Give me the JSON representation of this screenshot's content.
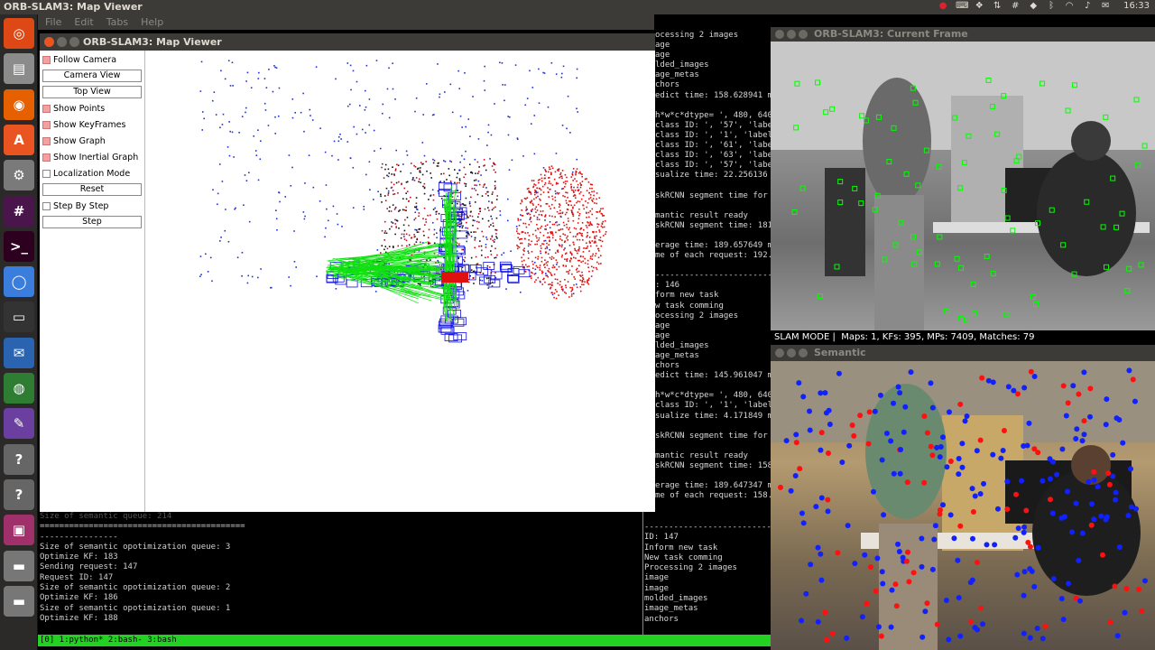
{
  "topbar": {
    "title": "ORB-SLAM3: Map Viewer",
    "clock": "16:33",
    "tray_icons": [
      "record-icon",
      "keyboard-icon",
      "dropbox-icon",
      "network-icon",
      "slack-icon",
      "vscode-icon",
      "bluetooth-icon",
      "wifi-icon",
      "volume-icon",
      "mail-icon"
    ]
  },
  "menubar": {
    "items": [
      "File",
      "Edit",
      "Tabs",
      "Help"
    ]
  },
  "launcher": {
    "items": [
      "ubuntu-icon",
      "files-icon",
      "firefox-icon",
      "software-center-icon",
      "settings-icon",
      "slack-icon",
      "terminal-icon",
      "chromium-icon",
      "screen-icon",
      "thunderbird-icon",
      "globe-icon",
      "brush-icon",
      "help-icon",
      "help-icon",
      "window-icon",
      "drive-icon",
      "drive-icon"
    ]
  },
  "map_viewer": {
    "title": "ORB-SLAM3: Map Viewer",
    "options": [
      {
        "label": "Follow Camera",
        "kind": "checkbox",
        "checked": true
      },
      {
        "label": "Camera View",
        "kind": "button"
      },
      {
        "label": "Top View",
        "kind": "button"
      },
      {
        "label": "Show Points",
        "kind": "checkbox",
        "checked": true
      },
      {
        "label": "Show KeyFrames",
        "kind": "checkbox",
        "checked": true
      },
      {
        "label": "Show Graph",
        "kind": "checkbox",
        "checked": true
      },
      {
        "label": "Show Inertial Graph",
        "kind": "checkbox",
        "checked": true
      },
      {
        "label": "Localization Mode",
        "kind": "checkbox",
        "checked": false
      },
      {
        "label": "Reset",
        "kind": "button"
      },
      {
        "label": "Step By Step",
        "kind": "checkbox",
        "checked": false
      },
      {
        "label": "Step",
        "kind": "button"
      }
    ]
  },
  "console": {
    "lines": [
      "Size of semantic queue: 214",
      "==========================================",
      "----------------",
      "Size of semantic opotimization queue: 3",
      "Optimize KF: 183",
      "Sending request: 147",
      "Request ID: 147",
      "Size of semantic opotimization queue: 2",
      "Optimize KF: 186",
      "Size of semantic opotimization queue: 1",
      "Optimize KF: 188",
      ""
    ]
  },
  "right_log": {
    "lines": [
      "ocessing 2 images",
      "age",
      "age",
      "lded_images",
      "age_metas",
      "chors",
      "edict time: 158.628941 m",
      "",
      "h*w*c*dtype= ', 480, 640",
      "class ID: ', '57', 'labe",
      "class ID: ', '1', 'label",
      "class ID: ', '61', 'labe",
      "class ID: ', '63', 'labe",
      "class ID: ', '57', 'labe",
      "sualize time: 22.256136",
      "",
      "skRCNN segment time for",
      "",
      "mantic result ready",
      "skRCNN segment time: 181",
      "",
      "erage time: 189.657649 m",
      "me of each request: 192.",
      "",
      "--------------------------",
      ": 146",
      "form new task",
      "w task comming",
      "ocessing 2 images",
      "age",
      "age",
      "lded_images",
      "age_metas",
      "chors",
      "edict time: 145.961047 m",
      "",
      "h*w*c*dtype= ', 480, 640",
      "class ID: ', '1', 'label",
      "sualize time: 4.171849 m",
      "",
      "skRCNN segment time for",
      "",
      "mantic result ready",
      "skRCNN segment time: 158",
      "",
      "erage time: 189.647347 m",
      "me of each request: 158."
    ],
    "lines2": [
      "---------------------------",
      "ID: 147",
      "Inform new task",
      "New task comming",
      "Processing 2 images",
      "image",
      "image",
      "molded_images",
      "image_metas",
      "anchors"
    ]
  },
  "tmux": {
    "status": "[0] 1:python* 2:bash- 3:bash"
  },
  "current_frame": {
    "title": "ORB-SLAM3: Current Frame",
    "status": "SLAM MODE |  Maps: 1, KFs: 395, MPs: 7409, Matches: 79"
  },
  "semantic": {
    "title": "Semantic"
  },
  "colors": {
    "accent": "#e95420",
    "tmux": "#23d123",
    "feature": "#00ff00"
  }
}
